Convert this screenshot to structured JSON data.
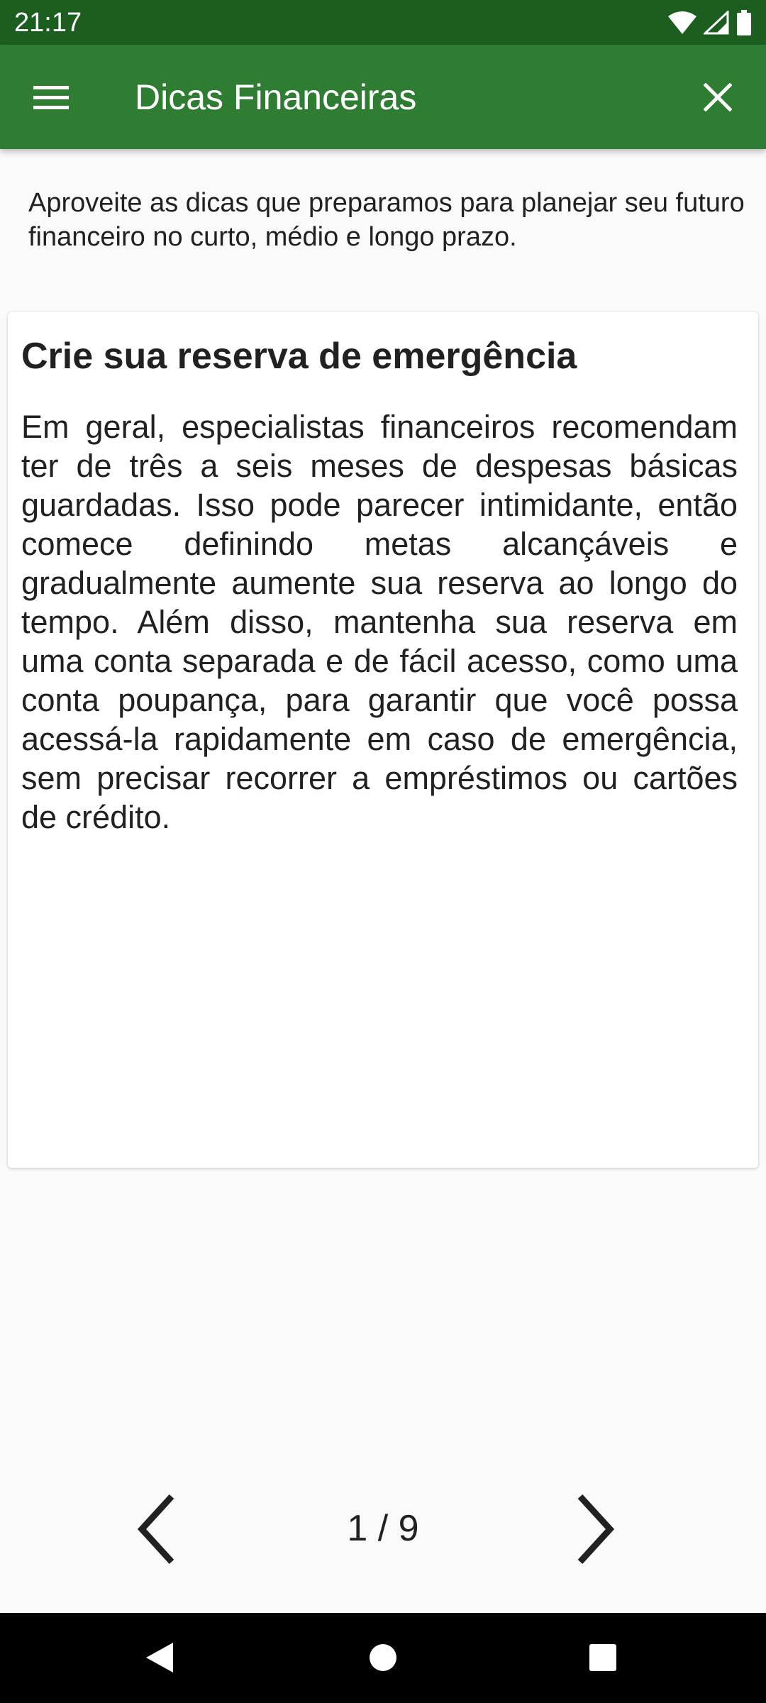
{
  "status_bar": {
    "time": "21:17",
    "icons": [
      "wifi-icon",
      "signal-icon",
      "battery-icon"
    ]
  },
  "app_bar": {
    "title": "Dicas Financeiras",
    "menu_icon": "menu-icon",
    "close_icon": "close-icon",
    "background_color": "#2e7d32"
  },
  "intro": "Aproveite as dicas que preparamos para planejar seu futuro financeiro no curto, médio e longo prazo.",
  "tip": {
    "title": "Crie sua reserva de emergência",
    "body": "Em geral, especialistas financeiros recomendam ter de três a seis meses de despesas básicas guardadas. Isso pode parecer intimidante, então comece definindo metas alcançáveis e gradualmente aumente sua reserva ao longo do tempo. Além disso, mantenha sua reserva em uma conta separada e de fácil acesso, como uma conta poupança, para garantir que você possa acessá-la rapidamente em caso de emergência, sem precisar recorrer a empréstimos ou cartões de crédito."
  },
  "pager": {
    "indicator": "1 / 9",
    "prev_icon": "chevron-left-icon",
    "next_icon": "chevron-right-icon"
  },
  "nav_bar": {
    "icons": [
      "back-icon",
      "home-icon",
      "recents-icon"
    ]
  }
}
